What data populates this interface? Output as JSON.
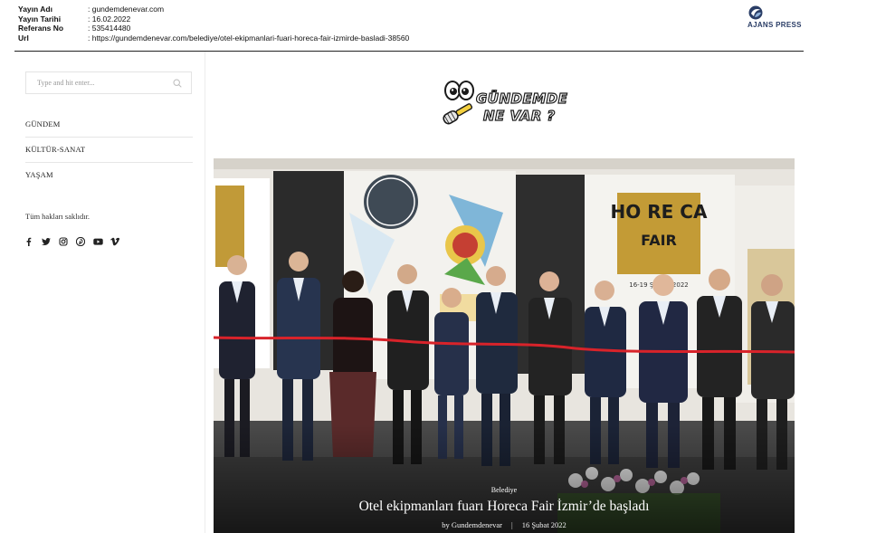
{
  "clip": {
    "rows": [
      {
        "key": "Yayın Adı",
        "value": ": gundemdenevar.com"
      },
      {
        "key": "Yayın Tarihi",
        "value": ": 16.02.2022"
      },
      {
        "key": "Referans No",
        "value": ": 535414480"
      },
      {
        "key": "Url",
        "value": ": https://gundemdenevar.com/belediye/otel-ekipmanlari-fuari-horeca-fair-izmirde-basladi-38560"
      }
    ],
    "agency": "AJANS PRESS"
  },
  "sidebar": {
    "search_placeholder": "Type and hit enter...",
    "menu": [
      {
        "label": "GÜNDEM"
      },
      {
        "label": "KÜLTÜR-SANAT"
      },
      {
        "label": "YAŞAM"
      }
    ],
    "rights": "Tüm hakları saklıdır.",
    "social_icons": [
      "facebook-icon",
      "twitter-icon",
      "instagram-icon",
      "pinterest-icon",
      "youtube-icon",
      "vimeo-icon"
    ]
  },
  "site": {
    "logo_text": "GÜNDEMDE NE VAR ?"
  },
  "hero": {
    "category": "Belediye",
    "title": "Otel ekipmanları fuarı Horeca Fair İzmir’de başladı",
    "author": "by Gundemdenevar",
    "date": "16 Şubat 2022",
    "banner_text_1": "HO RE CA",
    "banner_text_2": "FAIR",
    "banner_date": "16-19 ŞUBAT 2022",
    "accent": "#b8952f"
  }
}
